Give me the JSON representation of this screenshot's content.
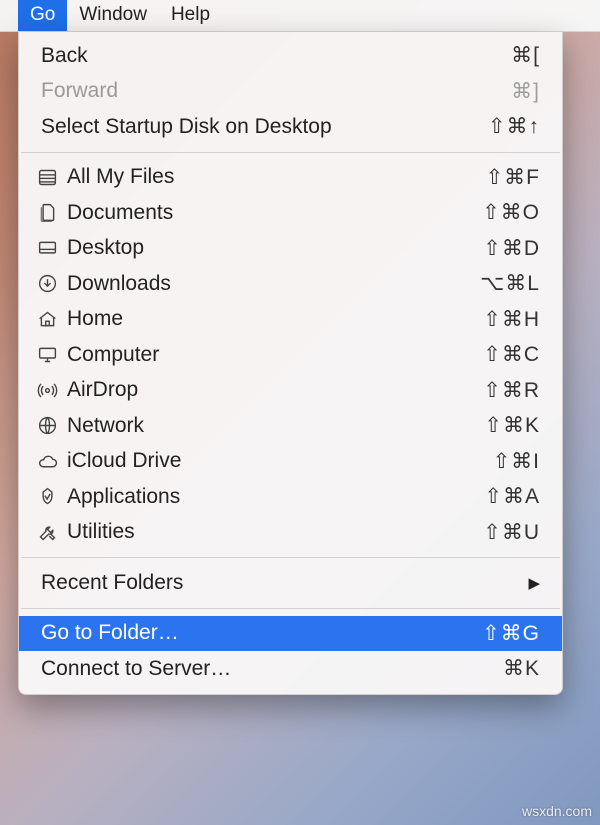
{
  "menubar": {
    "active": "Go",
    "items": [
      "Go",
      "Window",
      "Help"
    ]
  },
  "menu": {
    "section1": [
      {
        "id": "back",
        "label": "Back",
        "shortcut": "⌘[",
        "disabled": false
      },
      {
        "id": "forward",
        "label": "Forward",
        "shortcut": "⌘]",
        "disabled": true
      },
      {
        "id": "select-startup-disk",
        "label": "Select Startup Disk on Desktop",
        "shortcut": "⇧⌘↑",
        "disabled": false
      }
    ],
    "section2": [
      {
        "id": "all-my-files",
        "label": "All My Files",
        "shortcut": "⇧⌘F",
        "icon": "all-files-icon"
      },
      {
        "id": "documents",
        "label": "Documents",
        "shortcut": "⇧⌘O",
        "icon": "documents-icon"
      },
      {
        "id": "desktop",
        "label": "Desktop",
        "shortcut": "⇧⌘D",
        "icon": "desktop-icon"
      },
      {
        "id": "downloads",
        "label": "Downloads",
        "shortcut": "⌥⌘L",
        "icon": "downloads-icon"
      },
      {
        "id": "home",
        "label": "Home",
        "shortcut": "⇧⌘H",
        "icon": "home-icon"
      },
      {
        "id": "computer",
        "label": "Computer",
        "shortcut": "⇧⌘C",
        "icon": "computer-icon"
      },
      {
        "id": "airdrop",
        "label": "AirDrop",
        "shortcut": "⇧⌘R",
        "icon": "airdrop-icon"
      },
      {
        "id": "network",
        "label": "Network",
        "shortcut": "⇧⌘K",
        "icon": "network-icon"
      },
      {
        "id": "icloud-drive",
        "label": "iCloud Drive",
        "shortcut": "⇧⌘I",
        "icon": "icloud-icon"
      },
      {
        "id": "applications",
        "label": "Applications",
        "shortcut": "⇧⌘A",
        "icon": "applications-icon"
      },
      {
        "id": "utilities",
        "label": "Utilities",
        "shortcut": "⇧⌘U",
        "icon": "utilities-icon"
      }
    ],
    "section3": [
      {
        "id": "recent-folders",
        "label": "Recent Folders",
        "submenu": true
      }
    ],
    "section4": [
      {
        "id": "go-to-folder",
        "label": "Go to Folder…",
        "shortcut": "⇧⌘G",
        "selected": true
      },
      {
        "id": "connect-to-server",
        "label": "Connect to Server…",
        "shortcut": "⌘K"
      }
    ]
  },
  "watermark": "wsxdn.com",
  "colors": {
    "highlight": "#2b73ef",
    "menubar_active": "#1e6fe8"
  }
}
